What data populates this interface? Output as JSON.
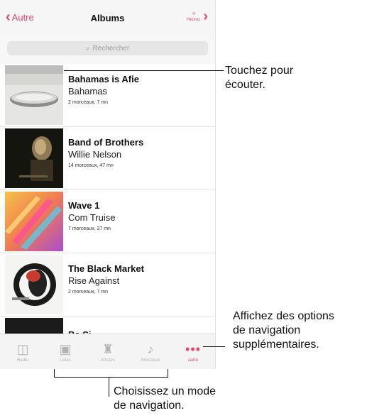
{
  "navbar": {
    "back_label": "Autre",
    "title": "Albums",
    "right_num": "4",
    "right_label": "Heures"
  },
  "search": {
    "placeholder": "Rechercher"
  },
  "albums": [
    {
      "title": "Bahamas is Afie",
      "artist": "Bahamas",
      "meta": "2 morceaux, 7 mn"
    },
    {
      "title": "Band of Brothers",
      "artist": "Willie Nelson",
      "meta": "14 morceaux, 47 mn"
    },
    {
      "title": "Wave 1",
      "artist": "Com Truise",
      "meta": "7 morceaux, 27 mn"
    },
    {
      "title": "The Black Market",
      "artist": "Rise Against",
      "meta": "2 morceaux, 7 mn"
    },
    {
      "title": "Ba Si",
      "artist": "",
      "meta": ""
    }
  ],
  "tabbar": [
    {
      "label": "Radio",
      "icon": "radio-icon"
    },
    {
      "label": "Listes",
      "icon": "playlists-icon"
    },
    {
      "label": "Artistes",
      "icon": "artists-icon"
    },
    {
      "label": "Morceaux",
      "icon": "music-note-icon"
    },
    {
      "label": "Autre",
      "icon": "more-icon"
    }
  ],
  "callouts": {
    "tap": "Touchez pour\nécouter.",
    "more": "Affichez des options\nde navigation\nsupplémentaires.",
    "choose": "Choisissez un mode\nde navigation."
  },
  "colors": {
    "accent": "#e6466e"
  }
}
